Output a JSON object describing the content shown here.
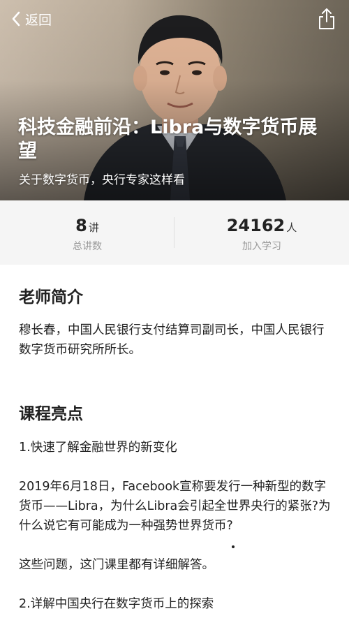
{
  "nav": {
    "back_label": "返回"
  },
  "hero": {
    "title": "科技金融前沿：Libra与数字货币展望",
    "subtitle": "关于数字货币，央行专家这样看"
  },
  "stats": [
    {
      "number": "8",
      "unit": "讲",
      "label": "总讲数"
    },
    {
      "number": "24162",
      "unit": "人",
      "label": "加入学习"
    }
  ],
  "teacher": {
    "heading": "老师简介",
    "bio": "穆长春，中国人民银行支付结算司副司长，中国人民银行数字货币研究所所长。"
  },
  "highlights": {
    "heading": "课程亮点",
    "items": [
      "1.快速了解金融世界的新变化",
      "2019年6月18日，Facebook宣称要发行一种新型的数字货币——Libra，为什么Libra会引起全世界央行的紧张?为什么说它有可能成为一种强势世界货币?",
      "这些问题，这门课里都有详细解答。",
      "2.详解中国央行在数字货币上的探索"
    ]
  },
  "colors": {
    "stats_background": "#f5f5f5",
    "label_gray": "#999999",
    "text": "#222222"
  }
}
